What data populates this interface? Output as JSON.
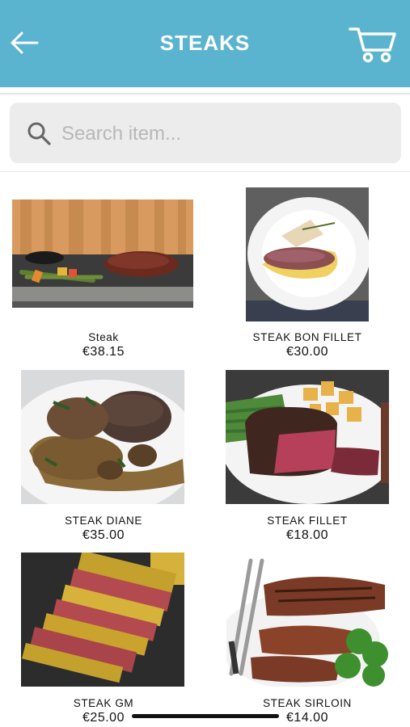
{
  "header": {
    "title": "STEAKS",
    "back_icon": "arrow-left-icon",
    "cart_icon": "shopping-cart-icon",
    "bg_color": "#5ab4cf"
  },
  "search": {
    "placeholder": "Search item...",
    "value": "",
    "icon": "search-icon"
  },
  "products": [
    {
      "name": "Steak",
      "price": "€38.15"
    },
    {
      "name": "STEAK BON FILLET",
      "price": "€30.00"
    },
    {
      "name": "STEAK DIANE",
      "price": "€35.00"
    },
    {
      "name": "STEAK FILLET",
      "price": "€18.00"
    },
    {
      "name": "STEAK GM",
      "price": "€25.00"
    },
    {
      "name": "STEAK SIRLOIN",
      "price": "€14.00"
    }
  ]
}
